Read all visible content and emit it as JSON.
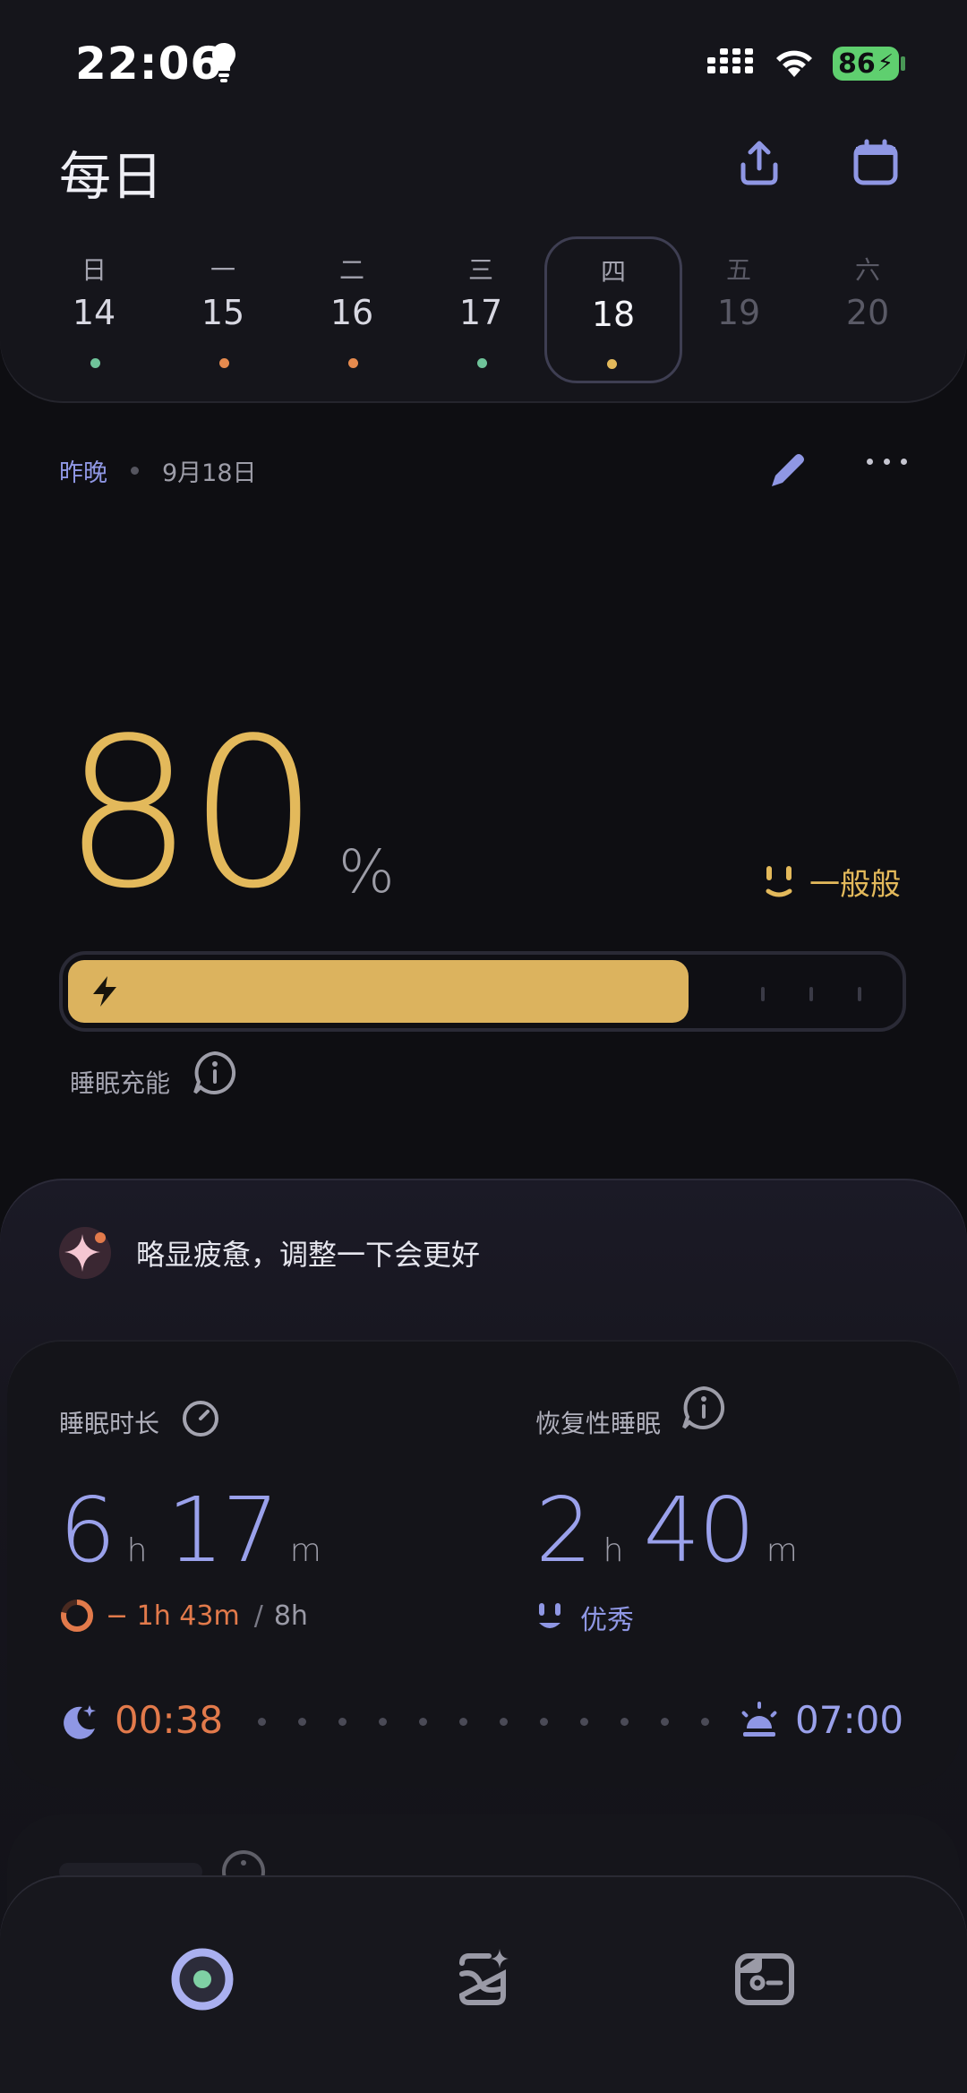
{
  "status_bar": {
    "time": "22:06",
    "battery": "86"
  },
  "header": {
    "title": "每日"
  },
  "week": [
    {
      "weekday": "日",
      "date": "14",
      "dot_color": "#6fc39a",
      "state": "past"
    },
    {
      "weekday": "一",
      "date": "15",
      "dot_color": "#e58a4e",
      "state": "past"
    },
    {
      "weekday": "二",
      "date": "16",
      "dot_color": "#e58a4e",
      "state": "past"
    },
    {
      "weekday": "三",
      "date": "17",
      "dot_color": "#6fc39a",
      "state": "past"
    },
    {
      "weekday": "四",
      "date": "18",
      "dot_color": "#e3b95b",
      "state": "selected"
    },
    {
      "weekday": "五",
      "date": "19",
      "dot_color": "",
      "state": "future"
    },
    {
      "weekday": "六",
      "date": "20",
      "dot_color": "",
      "state": "future"
    }
  ],
  "subheader": {
    "period": "昨晚",
    "date": "9月18日"
  },
  "charge": {
    "score": "80",
    "unit": "%",
    "level": 0.8,
    "mood": "一般般",
    "label": "睡眠充能"
  },
  "insight": {
    "text": "略显疲惫，调整一下会更好"
  },
  "sleep_duration": {
    "label": "睡眠时长",
    "hours": "6",
    "hours_unit": "h",
    "minutes": "17",
    "minutes_unit": "m",
    "deficit": "− 1h 43m",
    "slash": "/",
    "goal": "8h"
  },
  "restorative_sleep": {
    "label": "恢复性睡眠",
    "hours": "2",
    "hours_unit": "h",
    "minutes": "40",
    "minutes_unit": "m",
    "rating": "优秀"
  },
  "timeline": {
    "bedtime": "00:38",
    "wake_time": "07:00"
  },
  "tabs": [
    {
      "icon": "sleep-ring-icon",
      "active": true
    },
    {
      "icon": "sparkle-card-icon",
      "active": false
    },
    {
      "icon": "profile-card-icon",
      "active": false
    }
  ],
  "colors": {
    "accent_gold": "#e3b95b",
    "accent_blue": "#9aa1eb",
    "accent_orange": "#e27a4b",
    "background": "#0e0e12"
  }
}
